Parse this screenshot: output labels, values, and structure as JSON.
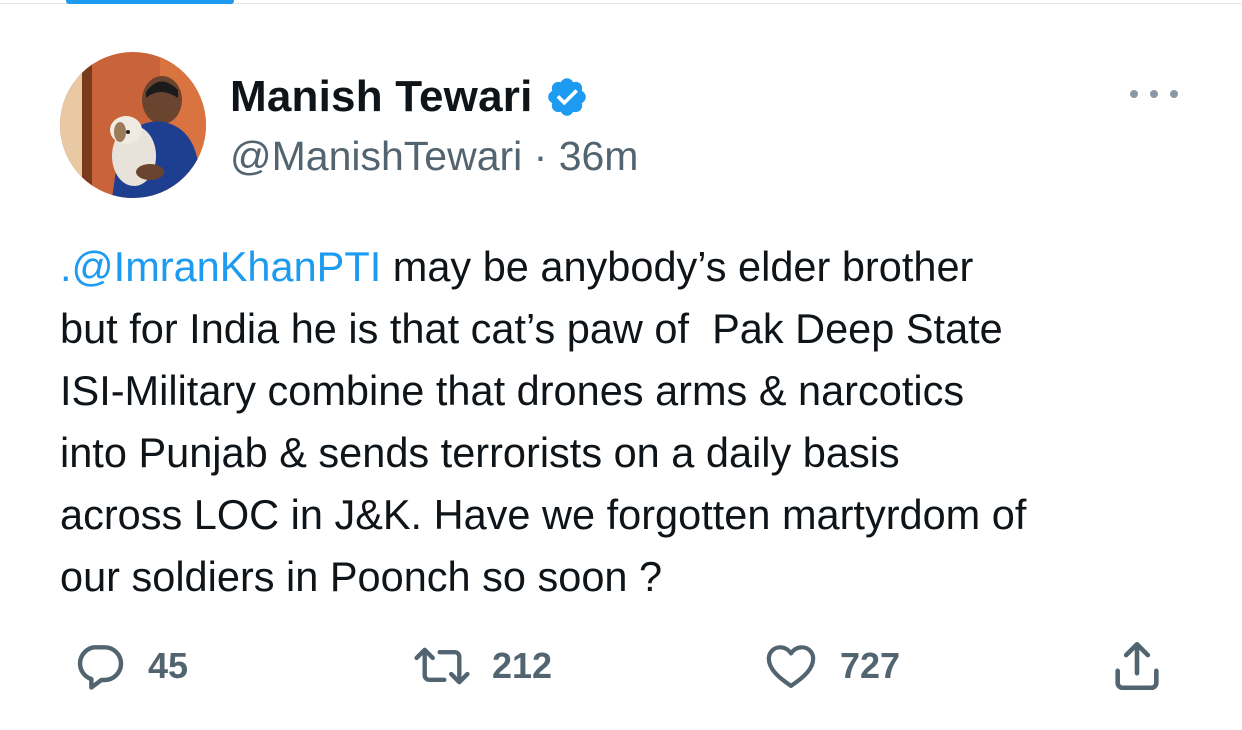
{
  "tweet": {
    "author": {
      "display_name": "Manish Tewari",
      "handle": "@ManishTewari",
      "time_separator": " · ",
      "time_ago": "36m",
      "verified": true
    },
    "text": {
      "mention": ".@ImranKhanPTI",
      "line1_rest": " may be anybody’s elder brother",
      "line2": "but for India he is that cat’s paw of  Pak Deep State",
      "line3": "ISI-Military combine that drones arms & narcotics",
      "line4": "into Punjab & sends terrorists on a daily basis",
      "line5": "across LOC in J&K. Have we forgotten martyrdom of",
      "line6": "our soldiers in Poonch so soon ?"
    },
    "stats": {
      "replies": "45",
      "retweets": "212",
      "likes": "727"
    }
  },
  "icons": {
    "verified": "verified-badge-icon",
    "more": "more-dots-icon",
    "reply": "reply-bubble-icon",
    "retweet": "retweet-arrows-icon",
    "like": "heart-icon",
    "share": "share-upload-icon"
  },
  "colors": {
    "accent": "#1d9bf0",
    "text_primary": "#0f1419",
    "text_secondary": "#536471"
  }
}
